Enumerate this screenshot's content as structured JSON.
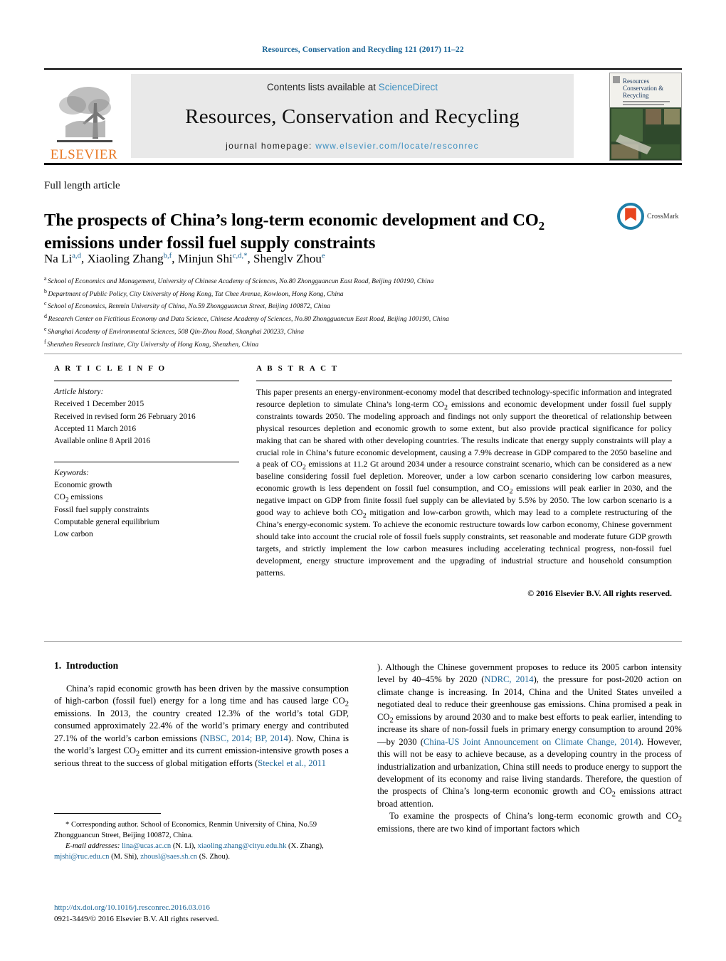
{
  "running_head": "Resources, Conservation and Recycling 121 (2017) 11–22",
  "masthead": {
    "contents_prefix": "Contents lists available at ",
    "sciencedirect": "ScienceDirect",
    "journal_title": "Resources, Conservation and Recycling",
    "homepage_prefix": "journal homepage: ",
    "homepage_url": "www.elsevier.com/locate/resconrec",
    "publisher_wordmark": "ELSEVIER",
    "cover_title_line1": "Resources",
    "cover_title_line2": "Conservation &",
    "cover_title_line3": "Recycling",
    "colors": {
      "band_background": "#e9e9e9",
      "link_blue": "#3c8fc0",
      "elsevier_orange": "#E87722",
      "running_head_blue": "#1a6496"
    }
  },
  "article": {
    "type": "Full length article",
    "title_part1": "The prospects of China’s long-term economic development and CO",
    "title_sub": "2",
    "title_part2": " emissions under fossil fuel supply constraints",
    "crossmark_label": "CrossMark",
    "authors": [
      {
        "name": "Na Li",
        "marks": "a,d",
        "sep": ", "
      },
      {
        "name": "Xiaoling Zhang",
        "marks": "b,f",
        "sep": ", "
      },
      {
        "name": "Minjun Shi",
        "marks": "c,d,*",
        "sep": ", "
      },
      {
        "name": "Shenglv Zhou",
        "marks": "e",
        "sep": ""
      }
    ],
    "affiliations": [
      {
        "mark": "a",
        "text": "School of Economics and Management, University of Chinese Academy of Sciences, No.80 Zhongguancun East Road, Beijing 100190, China"
      },
      {
        "mark": "b",
        "text": "Department of Public Policy, City University of Hong Kong, Tat Chee Avenue, Kowloon, Hong Kong, China"
      },
      {
        "mark": "c",
        "text": "School of Economics, Renmin University of China, No.59 Zhongguancun Street, Beijing 100872, China"
      },
      {
        "mark": "d",
        "text": "Research Center on Fictitious Economy and Data Science, Chinese Academy of Sciences, No.80 Zhongguancun East Road, Beijing 100190, China"
      },
      {
        "mark": "e",
        "text": "Shanghai Academy of Environmental Sciences, 508 Qin-Zhou Road, Shanghai 200233, China"
      },
      {
        "mark": "f",
        "text": "Shenzhen Research Institute, City University of Hong Kong, Shenzhen, China"
      }
    ]
  },
  "article_info": {
    "heading": "A R T I C L E   I N F O",
    "history_label": "Article history:",
    "history": [
      "Received 1 December 2015",
      "Received in revised form 26 February 2016",
      "Accepted 11 March 2016",
      "Available online 8 April 2016"
    ],
    "keywords_label": "Keywords:",
    "keywords": [
      "Economic growth",
      "CO2 emissions",
      "Fossil fuel supply constraints",
      "Computable general equilibrium",
      "Low carbon"
    ]
  },
  "abstract": {
    "heading": "A B S T R A C T",
    "paragraph_1": "This paper presents an energy-environment-economy model that described technology-specific information and integrated resource depletion to simulate China’s long-term CO",
    "paragraph_2": " emissions and economic development under fossil fuel supply constraints towards 2050. The modeling approach and findings not only support the theoretical of relationship between physical resources depletion and economic growth to some extent, but also provide practical significance for policy making that can be shared with other developing countries. The results indicate that energy supply constraints will play a crucial role in China’s future economic development, causing a 7.9% decrease in GDP compared to the 2050 baseline and a peak of CO",
    "paragraph_3": " emissions at 11.2 Gt around 2034 under a resource constraint scenario, which can be considered as a new baseline considering fossil fuel depletion. Moreover, under a low carbon scenario considering low carbon measures, economic growth is less dependent on fossil fuel consumption, and CO",
    "paragraph_4": " emissions will peak earlier in 2030, and the negative impact on GDP from finite fossil fuel supply can be alleviated by 5.5% by 2050. The low carbon scenario is a good way to achieve both CO",
    "paragraph_5": " mitigation and low-carbon growth, which may lead to a complete restructuring of the China’s energy-economic system. To achieve the economic restructure towards low carbon economy, Chinese government should take into account the crucial role of fossil fuels supply constraints, set reasonable and moderate future GDP growth targets, and strictly implement the low carbon measures including accelerating technical progress, non-fossil fuel development, energy structure improvement and the upgrading of industrial structure and household consumption patterns.",
    "copyright": "© 2016 Elsevier B.V. All rights reserved."
  },
  "body": {
    "section_number": "1.",
    "section_title": "Introduction",
    "left_p1_a": "China’s rapid economic growth has been driven by the massive consumption of high-carbon (fossil fuel) energy for a long time and has caused large CO",
    "left_p1_b": " emissions. In 2013, the country created 12.3% of the world’s total GDP, consumed approximately 22.4% of the world’s primary energy and contributed 27.1% of the world’s carbon emissions (",
    "left_ref1": "NBSC, 2014; BP, 2014",
    "left_p1_c": "). Now, China is the world’s largest CO",
    "left_p1_d": " emitter and its current emission-intensive growth poses a serious threat to the success of global mitigation efforts (",
    "left_ref2": "Steckel et al., 2011",
    "right_p1_a": "). Although the Chinese government proposes to reduce its 2005 carbon intensity level by 40–45% by 2020 (",
    "right_ref1": "NDRC, 2014",
    "right_p1_b": "), the pressure for post-2020 action on climate change is increasing. In 2014, China and the United States unveiled a negotiated deal to reduce their greenhouse gas emissions. China promised a peak in CO",
    "right_p1_c": " emissions by around 2030 and to make best efforts to peak earlier, intending to increase its share of non-fossil fuels in primary energy consumption to around 20%—by 2030 (",
    "right_ref2": "China-US Joint Announcement on Climate Change, 2014",
    "right_p1_d": "). However, this will not be easy to achieve because, as a developing country in the process of industrialization and urbanization, China still needs to produce energy to support the development of its economy and raise living standards. Therefore, the question of the prospects of China’s long-term economic growth and CO",
    "right_p1_e": " emissions attract broad attention.",
    "right_p2_a": "To examine the prospects of China’s long-term economic growth and CO",
    "right_p2_b": " emissions, there are two kind of important factors which"
  },
  "footnotes": {
    "corresponding_marker": "*",
    "corresponding_text": " Corresponding author. School of Economics, Renmin University of China, No.59 Zhongguancun Street, Beijing 100872, China.",
    "email_label": "E-mail addresses:",
    "emails": [
      {
        "address": "lina@ucas.ac.cn",
        "person": " (N. Li), "
      },
      {
        "address": "xiaoling.zhang@cityu.edu.hk",
        "person": " (X. Zhang), "
      },
      {
        "address": "mjshi@ruc.edu.cn",
        "person": " (M. Shi), "
      },
      {
        "address": "zhousl@saes.sh.cn",
        "person": " (S. Zhou)."
      }
    ],
    "doi": "http://dx.doi.org/10.1016/j.resconrec.2016.03.016",
    "issn_copyright": "0921-3449/© 2016 Elsevier B.V. All rights reserved."
  }
}
